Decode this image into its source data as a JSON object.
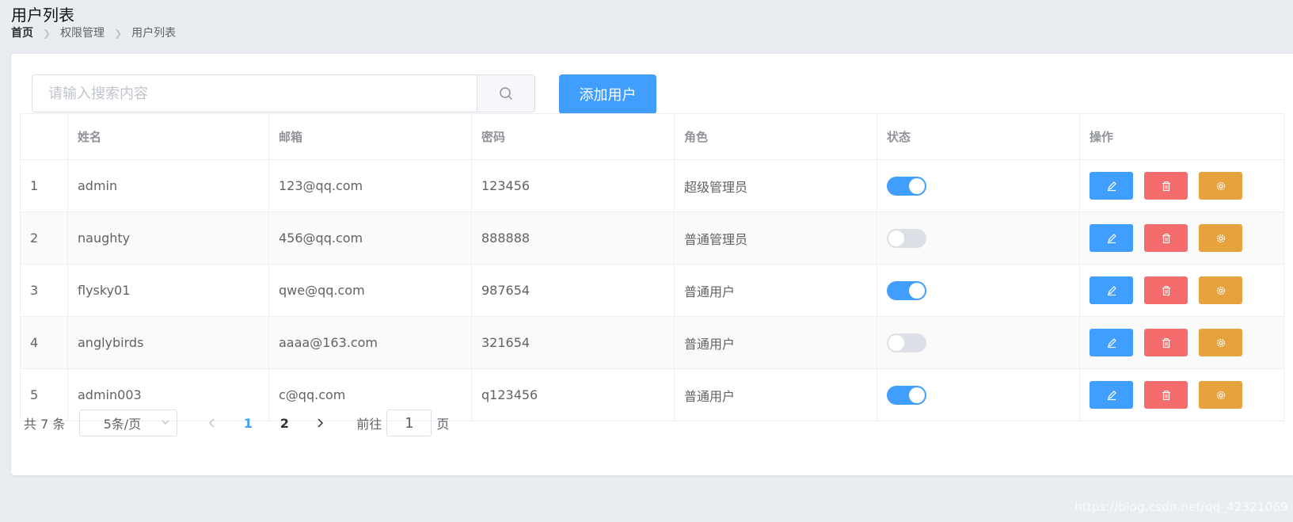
{
  "page": {
    "title": "用户列表"
  },
  "breadcrumb": [
    "首页",
    "权限管理",
    "用户列表"
  ],
  "search": {
    "placeholder": "请输入搜索内容",
    "value": ""
  },
  "toolbar": {
    "add_label": "添加用户"
  },
  "table": {
    "headers": [
      "",
      "姓名",
      "邮箱",
      "密码",
      "角色",
      "状态",
      "操作"
    ],
    "rows": [
      {
        "index": "1",
        "name": "admin",
        "email": "123@qq.com",
        "password": "123456",
        "role": "超级管理员",
        "status": true
      },
      {
        "index": "2",
        "name": "naughty",
        "email": "456@qq.com",
        "password": "888888",
        "role": "普通管理员",
        "status": false
      },
      {
        "index": "3",
        "name": "flysky01",
        "email": "qwe@qq.com",
        "password": "987654",
        "role": "普通用户",
        "status": true
      },
      {
        "index": "4",
        "name": "anglybirds",
        "email": "aaaa@163.com",
        "password": "321654",
        "role": "普通用户",
        "status": false
      },
      {
        "index": "5",
        "name": "admin003",
        "email": "c@qq.com",
        "password": "q123456",
        "role": "普通用户",
        "status": true
      }
    ],
    "row_actions": [
      "edit-icon",
      "delete-icon",
      "setting-icon"
    ]
  },
  "pagination": {
    "total_label": "共 7 条",
    "page_size_label": "5条/页",
    "pages": [
      "1",
      "2"
    ],
    "current_page": "1",
    "goto_label": "前往",
    "goto_value": "1",
    "page_suffix": "页"
  },
  "watermark": "https://blog.csdn.net/qq_42321069",
  "colors": {
    "primary": "#409eff",
    "danger": "#f56c6c",
    "warning": "#e6a23c",
    "switch_off": "#dcdfe6"
  }
}
